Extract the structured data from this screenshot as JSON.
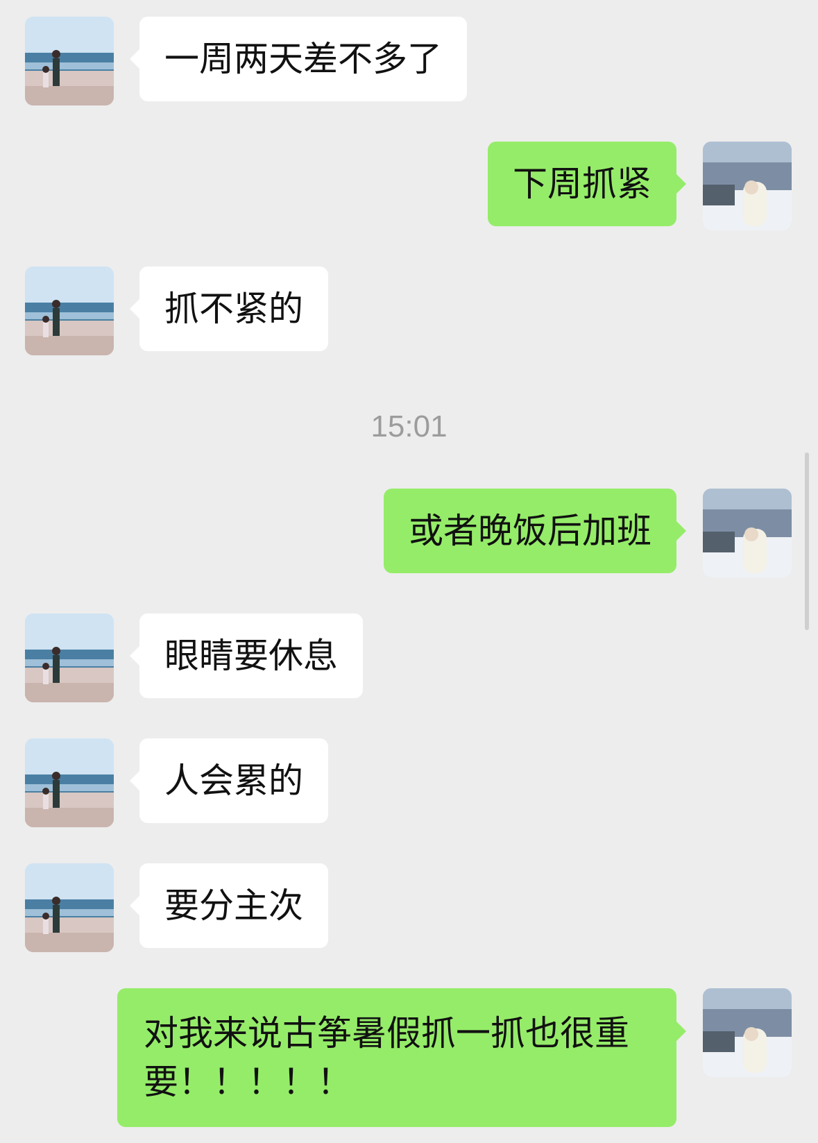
{
  "messages": [
    {
      "side": "in",
      "text": "一周两天差不多了"
    },
    {
      "side": "out",
      "text": "下周抓紧"
    },
    {
      "side": "in",
      "text": "抓不紧的"
    },
    {
      "side": "out",
      "text": "或者晚饭后加班"
    },
    {
      "side": "in",
      "text": "眼睛要休息"
    },
    {
      "side": "in",
      "text": "人会累的"
    },
    {
      "side": "in",
      "text": "要分主次"
    },
    {
      "side": "out",
      "text": "对我来说古筝暑假抓一抓也很重要！！！！！"
    }
  ],
  "timestamp": "15:01",
  "avatars": {
    "contact": "beach-walk-avatar",
    "self": "snowy-landscape-avatar"
  },
  "colors": {
    "background": "#ededed",
    "incoming_bubble": "#ffffff",
    "outgoing_bubble": "#95ec69",
    "timestamp_text": "#9c9c9c"
  }
}
